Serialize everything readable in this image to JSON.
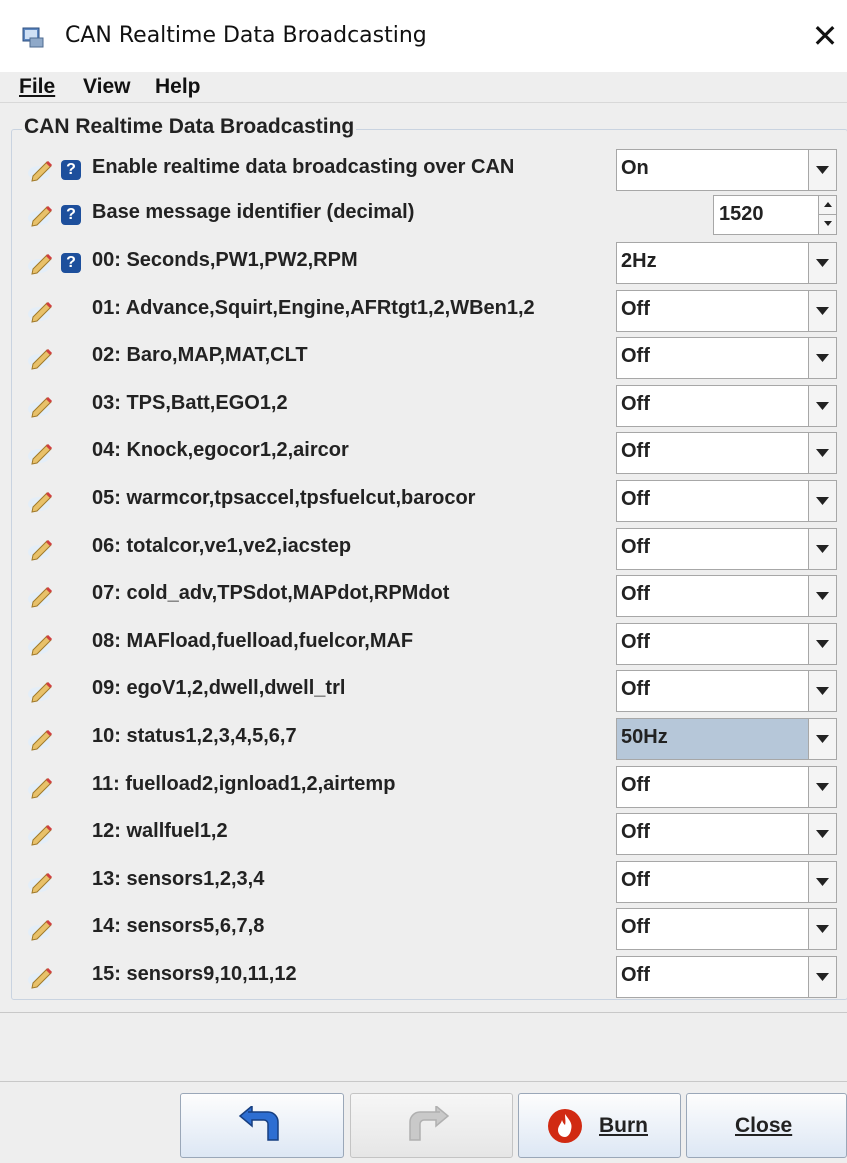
{
  "window": {
    "title": "CAN Realtime Data Broadcasting",
    "close_symbol": "✕"
  },
  "menu": [
    {
      "label": "File"
    },
    {
      "label": "View"
    },
    {
      "label": "Help"
    }
  ],
  "panel": {
    "title": "CAN Realtime Data Broadcasting"
  },
  "settings": {
    "enable": {
      "label": "Enable realtime data broadcasting over CAN",
      "value": "On"
    },
    "base_id": {
      "label": "Base message identifier (decimal)",
      "value": "1520"
    },
    "messages": [
      {
        "label": "00: Seconds,PW1,PW2,RPM",
        "value": "2Hz"
      },
      {
        "label": "01: Advance,Squirt,Engine,AFRtgt1,2,WBen1,2",
        "value": "Off"
      },
      {
        "label": "02: Baro,MAP,MAT,CLT",
        "value": "Off"
      },
      {
        "label": "03: TPS,Batt,EGO1,2",
        "value": "Off"
      },
      {
        "label": "04: Knock,egocor1,2,aircor",
        "value": "Off"
      },
      {
        "label": "05: warmcor,tpsaccel,tpsfuelcut,barocor",
        "value": "Off"
      },
      {
        "label": "06: totalcor,ve1,ve2,iacstep",
        "value": "Off"
      },
      {
        "label": "07: cold_adv,TPSdot,MAPdot,RPMdot",
        "value": "Off"
      },
      {
        "label": "08: MAFload,fuelload,fuelcor,MAF",
        "value": "Off"
      },
      {
        "label": "09: egoV1,2,dwell,dwell_trl",
        "value": "Off"
      },
      {
        "label": "10: status1,2,3,4,5,6,7",
        "value": "50Hz"
      },
      {
        "label": "11: fuelload2,ignload1,2,airtemp",
        "value": "Off"
      },
      {
        "label": "12: wallfuel1,2",
        "value": "Off"
      },
      {
        "label": "13: sensors1,2,3,4",
        "value": "Off"
      },
      {
        "label": "14: sensors5,6,7,8",
        "value": "Off"
      },
      {
        "label": "15: sensors9,10,11,12",
        "value": "Off"
      }
    ]
  },
  "buttons": {
    "burn": {
      "label": "Burn"
    },
    "close": {
      "label": "Close"
    }
  },
  "colors": {
    "help_icon": "#1d4f9c",
    "selected_combo": "#b6c7d9",
    "burn_icon": "#d12a12"
  }
}
